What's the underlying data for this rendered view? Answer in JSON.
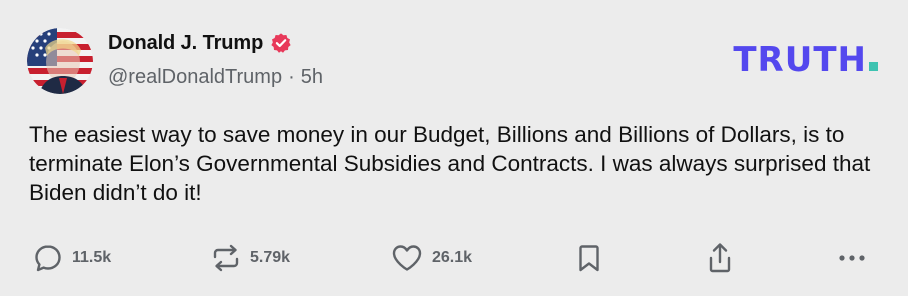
{
  "post": {
    "author_name": "Donald J. Trump",
    "handle": "@realDonaldTrump",
    "separator": "·",
    "time": "5h",
    "text": "The easiest way to save money in our Budget, Billions and Billions of Dollars, is to terminate Elon’s Governmental Subsidies and Contracts. I was always surprised that Biden didn’t do it!"
  },
  "brand": {
    "logo_text": "TRUTH",
    "logo_color": "#5448ee",
    "logo_dot_color": "#3ec3b1"
  },
  "badge": {
    "icon": "verified-badge-icon",
    "color": "#e8395a"
  },
  "actions": {
    "reply": {
      "icon": "reply-icon",
      "count": "11.5k"
    },
    "retruth": {
      "icon": "retruth-icon",
      "count": "5.79k"
    },
    "like": {
      "icon": "heart-icon",
      "count": "26.1k"
    },
    "bookmark": {
      "icon": "bookmark-icon"
    },
    "share": {
      "icon": "share-icon"
    },
    "more": {
      "icon": "more-icon"
    }
  },
  "colors": {
    "background": "#ececec",
    "text": "#111111",
    "muted": "#5f6368"
  }
}
